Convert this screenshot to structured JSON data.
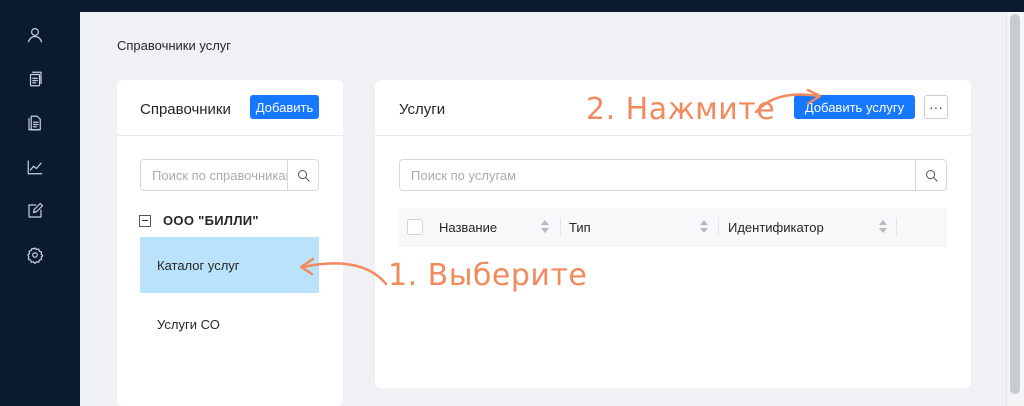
{
  "nav": {
    "items": [
      {
        "icon": "user-icon"
      },
      {
        "icon": "documents-icon"
      },
      {
        "icon": "document-list-icon"
      },
      {
        "icon": "chart-icon"
      },
      {
        "icon": "edit-icon"
      },
      {
        "icon": "settings-icon"
      }
    ]
  },
  "page": {
    "title": "Справочники услуг"
  },
  "directories": {
    "title": "Справочники",
    "add_label": "Добавить",
    "search_placeholder": "Поиск по справочникам",
    "org_name": "ООО \"БИЛЛИ\"",
    "items": [
      {
        "label": "Каталог услуг",
        "selected": true
      },
      {
        "label": "Услуги СО",
        "selected": false
      }
    ]
  },
  "services": {
    "title": "Услуги",
    "add_label": "Добавить услугу",
    "more_label": "···",
    "search_placeholder": "Поиск по услугам",
    "columns": [
      {
        "label": "Название"
      },
      {
        "label": "Тип"
      },
      {
        "label": "Идентификатор"
      }
    ]
  },
  "annotations": {
    "step1": "1. Выберите",
    "step2": "2. Нажмите"
  },
  "colors": {
    "sidebar": "#0b1a2e",
    "primary": "#1677ff",
    "selected": "#bae3fb",
    "annotation": "#f28a5e"
  }
}
